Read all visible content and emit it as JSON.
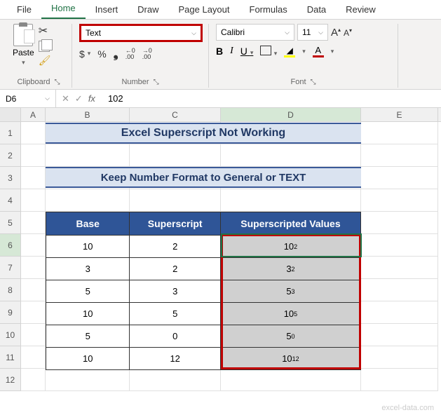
{
  "tabs": [
    "File",
    "Home",
    "Insert",
    "Draw",
    "Page Layout",
    "Formulas",
    "Data",
    "Review"
  ],
  "activeTab": "Home",
  "clipboard": {
    "paste": "Paste",
    "label": "Clipboard"
  },
  "number": {
    "format": "Text",
    "label": "Number",
    "dollar": "$",
    "percent": "%",
    "comma": "❟",
    "inc": ".00\n→.0",
    "dec": ".0\n→.00"
  },
  "font": {
    "name": "Calibri",
    "size": "11",
    "label": "Font",
    "bold": "B",
    "italic": "I",
    "underline": "U",
    "growA": "A",
    "shrinkA": "A",
    "fontA": "A"
  },
  "nameBox": "D6",
  "formulaValue": "102",
  "columns": [
    "A",
    "B",
    "C",
    "D",
    "E"
  ],
  "rowNums": [
    "1",
    "2",
    "3",
    "4",
    "5",
    "6",
    "7",
    "8",
    "9",
    "10",
    "11",
    "12"
  ],
  "title1": "Excel Superscript Not Working",
  "title2": "Keep Number Format to General or TEXT",
  "headers": {
    "base": "Base",
    "superscript": "Superscript",
    "values": "Superscripted Values"
  },
  "data": [
    {
      "base": "10",
      "sup": "2",
      "valBase": "10",
      "valSup": "2"
    },
    {
      "base": "3",
      "sup": "2",
      "valBase": "3",
      "valSup": "2"
    },
    {
      "base": "5",
      "sup": "3",
      "valBase": "5",
      "valSup": "3"
    },
    {
      "base": "10",
      "sup": "5",
      "valBase": "10",
      "valSup": "5"
    },
    {
      "base": "5",
      "sup": "0",
      "valBase": "5",
      "valSup": "0"
    },
    {
      "base": "10",
      "sup": "12",
      "valBase": "10",
      "valSup": "12"
    }
  ],
  "watermark": "excel-data.com"
}
